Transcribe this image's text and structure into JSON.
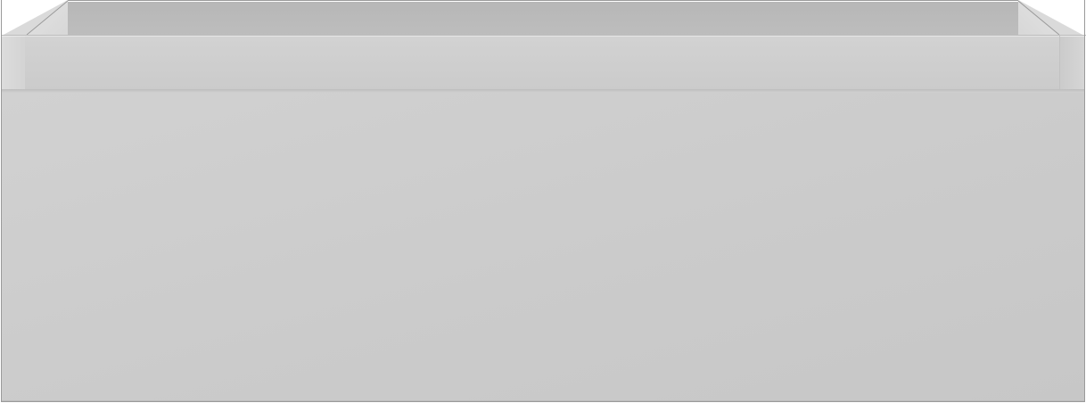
{
  "scene": {
    "object": "open-rectangular-storage-box",
    "colors": {
      "front_panel": "#cbcbcb",
      "rim": "#d2d2d2",
      "inner_back": "#b9b9b9",
      "outline": "#9a9a9a"
    }
  }
}
